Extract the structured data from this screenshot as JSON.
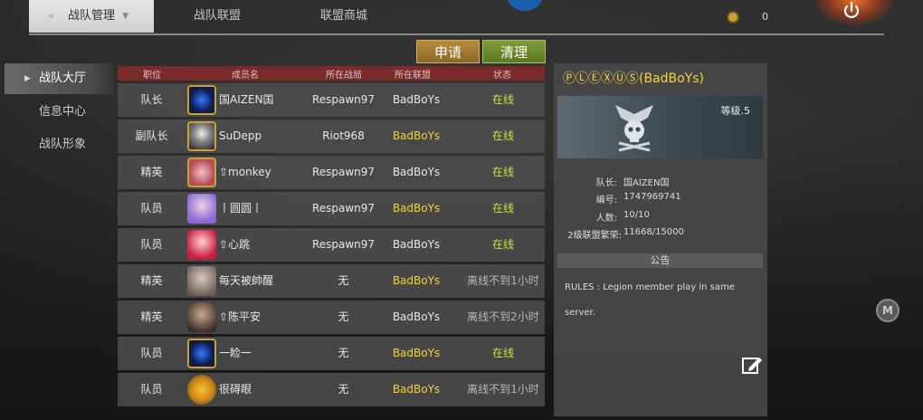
{
  "top_tabs": [
    {
      "label": "战队管理",
      "active": true
    },
    {
      "label": "战队联盟",
      "active": false
    },
    {
      "label": "联盟商城",
      "active": false
    }
  ],
  "currency": {
    "value": "0"
  },
  "actions": {
    "apply": "申请",
    "clean": "清理"
  },
  "nav": [
    {
      "label": "战队大厅",
      "active": true
    },
    {
      "label": "信息中心",
      "active": false
    },
    {
      "label": "战队形象",
      "active": false
    }
  ],
  "table": {
    "headers": {
      "role": "职位",
      "name": "成员名",
      "battle": "所在战局",
      "legion": "所在联盟",
      "status": "状态"
    },
    "rows": [
      {
        "role": "队长",
        "name": "国AIZEN国",
        "battle": "Respawn97",
        "legion": "BadBoYs",
        "status": "在线"
      },
      {
        "role": "副队长",
        "name": "SuDepp",
        "battle": "Riot968",
        "legion": "BadBoYs",
        "status": "在线"
      },
      {
        "role": "精英",
        "name": "⇧monkey",
        "battle": "Respawn97",
        "legion": "BadBoYs",
        "status": "在线"
      },
      {
        "role": "队员",
        "name": "丨圆圆丨",
        "battle": "Respawn97",
        "legion": "BadBoYs",
        "status": "在线"
      },
      {
        "role": "队员",
        "name": "⇧心跳",
        "battle": "Respawn97",
        "legion": "BadBoYs",
        "status": "在线"
      },
      {
        "role": "精英",
        "name": "每天被帥醒",
        "battle": "无",
        "legion": "BadBoYs",
        "status": "离线不到1小时"
      },
      {
        "role": "精英",
        "name": "⇧陈平安",
        "battle": "无",
        "legion": "BadBoYs",
        "status": "离线不到2小时"
      },
      {
        "role": "队员",
        "name": "一睑一",
        "battle": "无",
        "legion": "BadBoYs",
        "status": "在线"
      },
      {
        "role": "队员",
        "name": "很碍眼",
        "battle": "无",
        "legion": "BadBoYs",
        "status": "离线不到1小时"
      }
    ]
  },
  "legion": {
    "title": "ⓅⓁⒺⓍⓊⓈ(BadBoYs)",
    "level": "等级.5",
    "info": [
      {
        "key": "队长:",
        "value": "国AIZEN国"
      },
      {
        "key": "编号:",
        "value": "1747969741"
      },
      {
        "key": "人数:",
        "value": "10/10"
      },
      {
        "key": "2级联盟繁荣:",
        "value": "11668/15000"
      }
    ],
    "notice_title": "公告",
    "rules_line1": "RULES : Legion member play in same",
    "rules_line2": "server."
  },
  "colors": {
    "legion_yellow": "#f2d43a",
    "online_green": "#c9e23f",
    "header_red": "#7c2a2a"
  }
}
